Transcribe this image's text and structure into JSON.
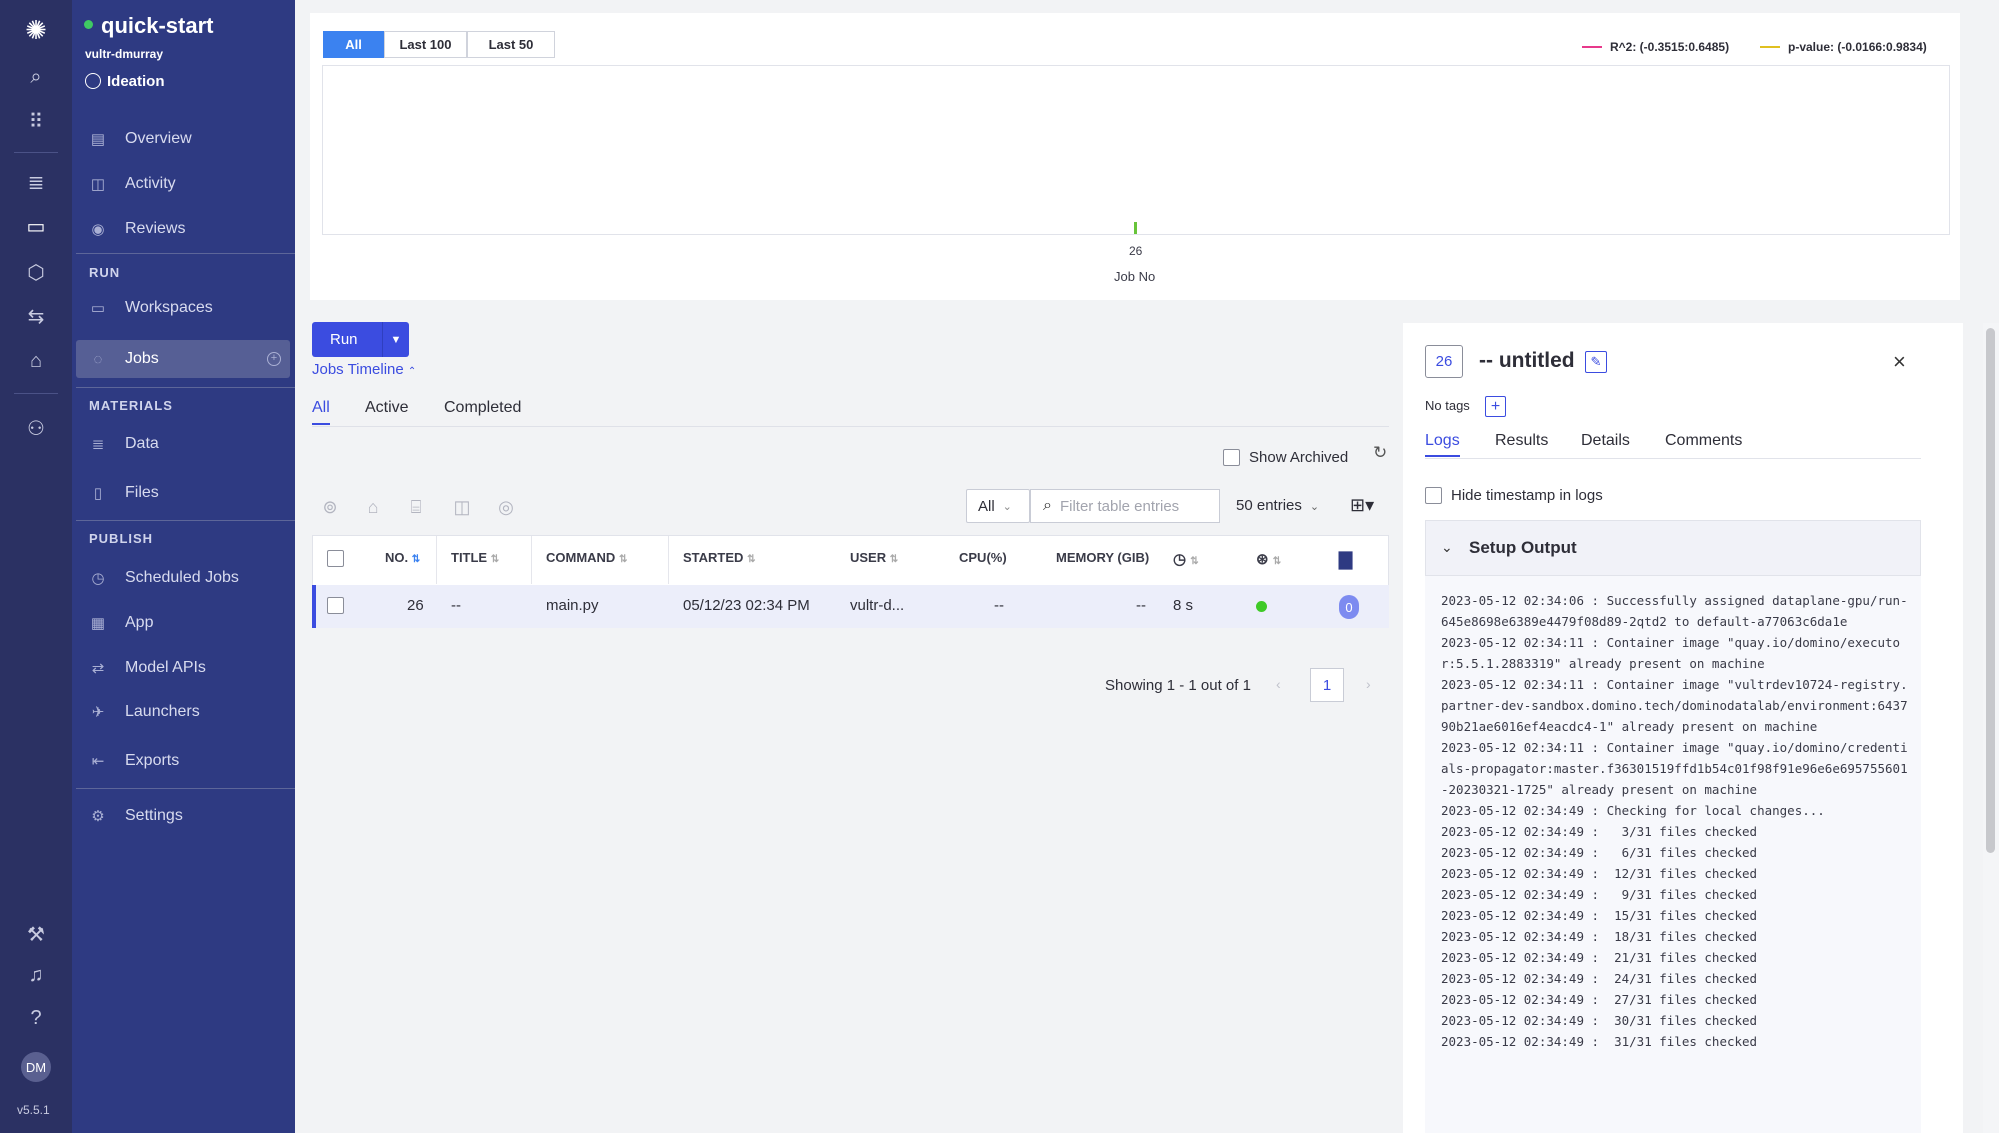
{
  "rail": {
    "icons": [
      "domino-logo-icon",
      "search-icon",
      "grid-icon",
      "database-icon",
      "folder-icon",
      "cube-icon",
      "transfer-icon",
      "tag-icon",
      "network-icon",
      "wrench-icon",
      "bell-icon",
      "help-icon"
    ],
    "avatar": "DM",
    "version": "v5.5.1"
  },
  "project": {
    "name": "quick-start",
    "owner": "vultr-dmurray",
    "stage": "Ideation"
  },
  "nav": {
    "overview": "Overview",
    "activity": "Activity",
    "reviews": "Reviews",
    "run_header": "RUN",
    "workspaces": "Workspaces",
    "jobs": "Jobs",
    "materials_header": "MATERIALS",
    "data": "Data",
    "files": "Files",
    "publish_header": "PUBLISH",
    "scheduled_jobs": "Scheduled Jobs",
    "app": "App",
    "model_apis": "Model APIs",
    "launchers": "Launchers",
    "exports": "Exports",
    "settings": "Settings"
  },
  "chart": {
    "ranges": [
      "All",
      "Last 100",
      "Last 50"
    ],
    "selected_range": "All",
    "legend": [
      {
        "label": "R^2: (-0.3515:0.6485)",
        "color": "#e7398b"
      },
      {
        "label": "p-value: (-0.0166:0.9834)",
        "color": "#e0c020"
      }
    ],
    "tick": "26",
    "xlabel": "Job No"
  },
  "chart_data": {
    "type": "bar",
    "categories": [
      "26"
    ],
    "values": [
      1
    ],
    "xlabel": "Job No",
    "ylabel": "",
    "legend": [
      "R^2: (-0.3515:0.6485)",
      "p-value: (-0.0166:0.9834)"
    ]
  },
  "jobs": {
    "run_label": "Run",
    "timeline_label": "Jobs Timeline",
    "tabs": [
      "All",
      "Active",
      "Completed"
    ],
    "show_archived": "Show Archived",
    "filter_select": "All",
    "filter_placeholder": "Filter table entries",
    "entries": "50 entries",
    "columns": [
      "NO.",
      "TITLE",
      "COMMAND",
      "STARTED",
      "USER",
      "CPU(%)",
      "MEMORY (GIB)"
    ],
    "row": {
      "no": "26",
      "title": "--",
      "command": "main.py",
      "started": "05/12/23 02:34 PM",
      "user": "vultr-d...",
      "cpu": "--",
      "memory": "--",
      "duration": "8 s",
      "comments": "0"
    },
    "pagination": "Showing 1 - 1 out of 1",
    "page": "1"
  },
  "detail": {
    "number": "26",
    "title": "-- untitled",
    "no_tags": "No tags",
    "tabs": [
      "Logs",
      "Results",
      "Details",
      "Comments"
    ],
    "hide_timestamp": "Hide timestamp in logs",
    "setup_output": "Setup Output",
    "log": "2023-05-12 02:34:06 : Successfully assigned dataplane-gpu/run-645e8698e6389e4479f08d89-2qtd2 to default-a77063c6da1e\n2023-05-12 02:34:11 : Container image \"quay.io/domino/executor:5.5.1.2883319\" already present on machine\n2023-05-12 02:34:11 : Container image \"vultrdev10724-registry.partner-dev-sandbox.domino.tech/dominodatalab/environment:643790b21ae6016ef4eacdc4-1\" already present on machine\n2023-05-12 02:34:11 : Container image \"quay.io/domino/credentials-propagator:master.f36301519ffd1b54c01f98f91e96e6e695755601-20230321-1725\" already present on machine\n2023-05-12 02:34:49 : Checking for local changes...\n2023-05-12 02:34:49 :   3/31 files checked\n2023-05-12 02:34:49 :   6/31 files checked\n2023-05-12 02:34:49 :  12/31 files checked\n2023-05-12 02:34:49 :   9/31 files checked\n2023-05-12 02:34:49 :  15/31 files checked\n2023-05-12 02:34:49 :  18/31 files checked\n2023-05-12 02:34:49 :  21/31 files checked\n2023-05-12 02:34:49 :  24/31 files checked\n2023-05-12 02:34:49 :  27/31 files checked\n2023-05-12 02:34:49 :  30/31 files checked\n2023-05-12 02:34:49 :  31/31 files checked"
  }
}
